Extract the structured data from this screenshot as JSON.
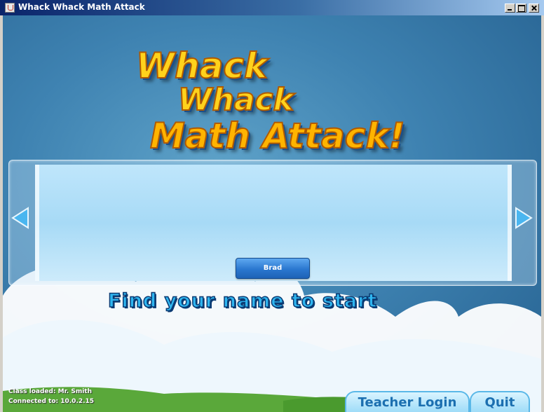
{
  "window": {
    "title": "Whack Whack Math Attack"
  },
  "logo": {
    "line1": "Whack",
    "line2": "Whack",
    "line3": "Math Attack!"
  },
  "selector": {
    "names": [
      "Brad"
    ],
    "prev_icon": "arrow-left-icon",
    "next_icon": "arrow-right-icon"
  },
  "prompt": "Find your name to start",
  "status": {
    "class_loaded": "Class loaded: Mr. Smith",
    "connected": "Connected to: 10.0.2.15"
  },
  "buttons": {
    "teacher_login": "Teacher Login",
    "quit": "Quit"
  },
  "colors": {
    "background": "#3e82b1",
    "logo_yellow": "#ffd21c",
    "prompt_blue": "#2fb6f0",
    "button_blue": "#2a77cf"
  }
}
